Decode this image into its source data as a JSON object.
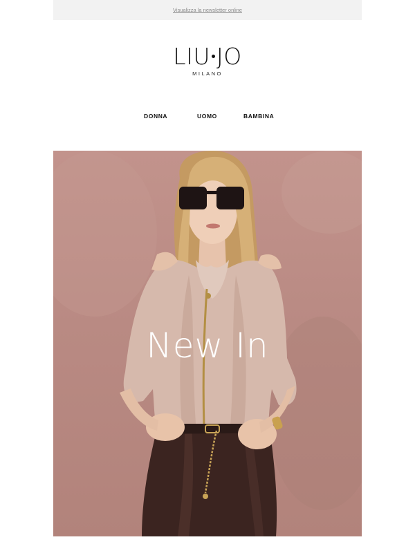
{
  "preheader": {
    "link_text": "Visualizza la newsletter online"
  },
  "brand": {
    "logo_text": "LIU JO",
    "sub_text": "MILANO"
  },
  "nav": {
    "items": [
      {
        "label": "DONNA"
      },
      {
        "label": "UOMO"
      },
      {
        "label": "BAMBINA"
      }
    ]
  },
  "hero": {
    "title": "New In",
    "image_icon": "fashion-model-photo",
    "colors": {
      "background": "#b98a83",
      "blouse": "#d9bfb1",
      "skirt": "#3a2420",
      "hair": "#d2ac74"
    }
  }
}
